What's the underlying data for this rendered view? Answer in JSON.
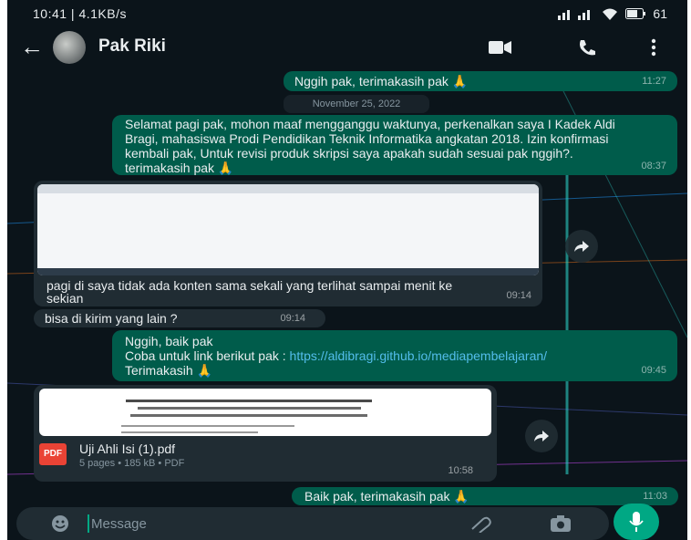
{
  "status": {
    "time_speed": "10:41 | 4.1KB/s",
    "battery": "61"
  },
  "header": {
    "contact_name": "Pak Riki"
  },
  "date_chip": "November 25, 2022",
  "messages": [
    {
      "text": "Nggih pak, terimakasih pak 🙏",
      "time": "11:27"
    },
    {
      "text": "Selamat pagi pak, mohon maaf mengganggu waktunya, perkenalkan saya I Kadek Aldi Bragi, mahasiswa Prodi Pendidikan Teknik Informatika angkatan 2018. Izin konfirmasi kembali pak, Untuk revisi produk skripsi saya apakah sudah sesuai pak nggih?. terimakasih pak 🙏",
      "time": "08:37"
    },
    {
      "caption": "pagi di saya tidak ada konten sama sekali yang terlihat sampai menit ke sekian",
      "time": "09:14"
    },
    {
      "text": "bisa di kirim yang lain ?",
      "time": "09:14"
    },
    {
      "line1": "Nggih, baik pak",
      "line2_prefix": "Coba untuk link berikut pak : ",
      "link": "https://aldibragi.github.io/mediapembelajaran/",
      "line3": "Terimakasih 🙏",
      "time": "09:45"
    },
    {
      "file_name": "Uji Ahli Isi (1).pdf",
      "file_meta": "5 pages • 185 kB • PDF",
      "file_badge": "PDF",
      "time": "10:58"
    },
    {
      "text": "Baik pak, terimakasih pak 🙏",
      "time": "11:03"
    }
  ],
  "input": {
    "placeholder": "Message"
  },
  "colors": {
    "outgoing": "#005c4b",
    "incoming": "#202c33",
    "background": "#0b141a",
    "accent": "#00a884",
    "link": "#53bdeb"
  }
}
